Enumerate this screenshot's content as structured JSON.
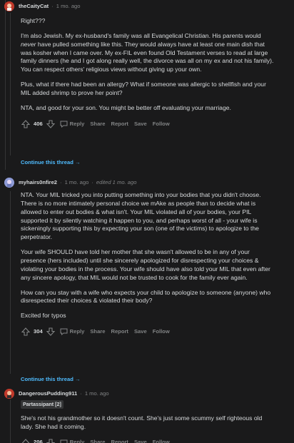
{
  "comments": [
    {
      "author": "theCaityCat",
      "time": "1 mo. ago",
      "paragraphs": [
        "Right???",
        "I'm also Jewish. My ex-husband's family was all Evangelical Christian. His parents would never have pulled something like this. They would always have at least one main dish that was kosher when I came over. My ex-FIL even found Old Testament verses to read at large family dinners (he and I got along really well, the divorce was all on my ex and not his family). You can respect others' religious views without giving up your own.",
        "Plus, what if there had been an allergy? What if someone was allergic to shellfish and your MIL added shrimp to prove her point?",
        "NTA, and good for your son. You might be better off evaluating your marriage."
      ],
      "score": "406",
      "continue": "Continue this thread"
    },
    {
      "author": "myhairs0nfire2",
      "time": "1 mo. ago",
      "edited": "edited 1 mo. ago",
      "paragraphs": [
        "NTA. Your MIL tricked you into putting something into your bodies that you didn't choose. There is no more intimately personal choice we mAke as people than to decide what is allowed to enter out bodies & what isn't. Your MIL violated all of your bodies, your PIL supported it by silently watching it happen to you, and perhaps worst of all - your wife is sickeningly supporting this by expecting your son (one of the victims) to apologize to the perpetrator.",
        "Your wife SHOULD have told her mother that she wasn't allowed to be in any of your presence (hers included) until she sincerely apologized for disrespecting your choices & violating your bodies in the process. Your wife should have also told your MIL that even after any sincere apology, that MIL would not be trusted to cook for the family ever again.",
        "How can you stay with a wife who expects your child to apologize to someone (anyone) who disrespected their choices & violated their body?",
        "Excited for typos"
      ],
      "score": "304",
      "continue": "Continue this thread"
    },
    {
      "author": "DangerousPudding911",
      "time": "1 mo. ago",
      "flair": "Partassipant [2]",
      "paragraphs": [
        "She's not his grandmother so it doesn't count. She's just some scummy self righteous old lady. She had it coming."
      ],
      "score": "206"
    }
  ],
  "actions": {
    "reply": "Reply",
    "share": "Share",
    "report": "Report",
    "save": "Save",
    "follow": "Follow"
  },
  "separator": "·",
  "arrow": "→",
  "icons": [
    "upvote-icon",
    "downvote-icon",
    "reply-icon",
    "continue-arrow-icon"
  ],
  "colors": {
    "background": "#1a1a1b",
    "text": "#d7dadc",
    "meta": "#818384",
    "link": "#4fbcff",
    "avatar1": "#c0392b",
    "avatar2": "#8e9bd6",
    "avatar3": "#c0392b"
  }
}
